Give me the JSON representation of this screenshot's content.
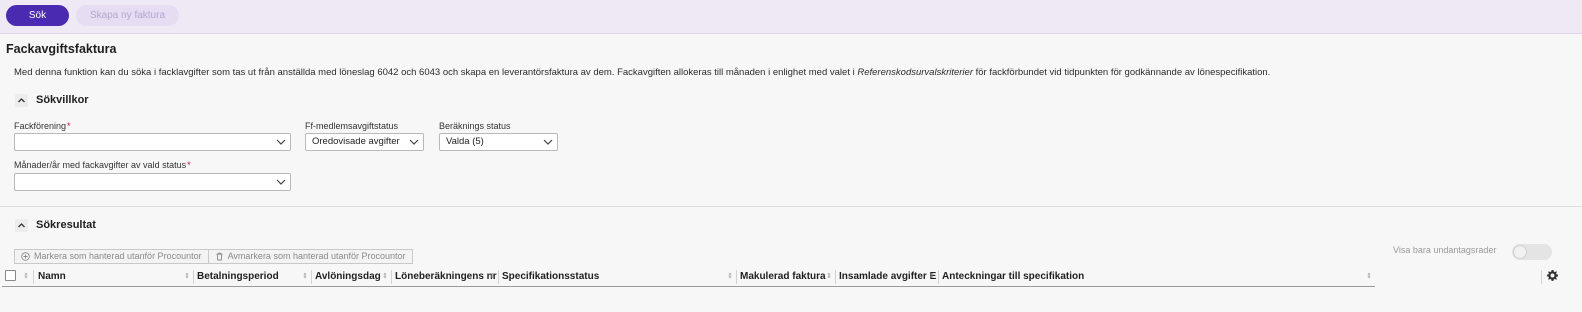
{
  "toolbar": {
    "search_label": "Sök",
    "create_label": "Skapa ny faktura"
  },
  "page": {
    "title": "Fackavgiftsfaktura",
    "description_part1": "Med denna funktion kan du söka i facklavgifter som tas ut från anställda med löneslag 6042 och 6043 och skapa en leverantörsfaktura av dem. Fackavgiften allokeras till månaden i enlighet med valet i ",
    "description_italic": "Referenskodsurvalskriterier",
    "description_part2": " för fackförbundet vid tidpunkten för godkännande av lönespecifikation."
  },
  "criteria": {
    "title": "Sökvillkor",
    "union_label": "Fackförening",
    "union_value": "",
    "member_status_label": "Ff-medlemsavgiftstatus",
    "member_status_value": "Oredovisade avgifter",
    "calc_status_label": "Beräknings status",
    "calc_status_value": "Valda (5)",
    "months_label": "Månader/år med fackavgifter av vald status",
    "months_value": "",
    "required_mark": "*"
  },
  "results": {
    "title": "Sökresultat",
    "mark_handled_label": "Markera som hanterad utanför Procountor",
    "unmark_handled_label": "Avmarkera som hanterad utanför Procountor",
    "exceptions_toggle_label": "Visa bara undantagsrader",
    "exceptions_toggle_on": false,
    "columns": [
      "Namn",
      "Betalningsperiod",
      "Avlöningsdag",
      "Löneberäkningens nr",
      "Specifikationsstatus",
      "Makulerad faktura",
      "Insamlade avgifter E",
      "Anteckningar till specifikation"
    ],
    "sort_glyph": "⇕"
  },
  "colors": {
    "primary": "#4a2ab0",
    "topbar": "#efe9f6",
    "required": "#c8102e"
  }
}
